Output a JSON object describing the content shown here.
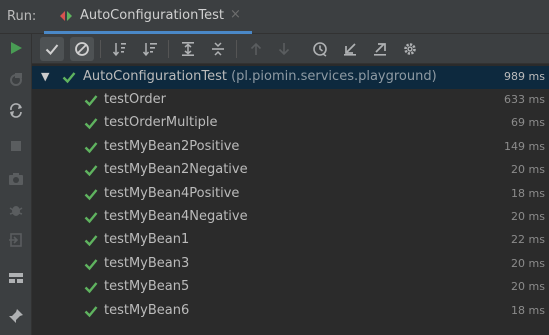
{
  "runbar": {
    "label": "Run:",
    "tab_title": "AutoConfigurationTest",
    "tab_close": "×"
  },
  "colors": {
    "pass": "#5fb35f",
    "accent": "#4a88c7",
    "run_green": "#499c54"
  },
  "toolbar": {
    "buttons": [
      {
        "name": "show-passed-toggle",
        "icon": "check-icon",
        "toggled": true
      },
      {
        "name": "show-ignored-toggle",
        "icon": "cancel-circle-icon",
        "toggled": true
      },
      {
        "name": "sort-alphabetically-button",
        "icon": "sort-alpha-icon"
      },
      {
        "name": "sort-by-duration-button",
        "icon": "sort-duration-icon"
      },
      {
        "name": "expand-all-button",
        "icon": "expand-all-icon"
      },
      {
        "name": "collapse-all-button",
        "icon": "collapse-all-icon"
      },
      {
        "name": "previous-failed-button",
        "icon": "arrow-up-icon"
      },
      {
        "name": "next-failed-button",
        "icon": "arrow-down-icon"
      },
      {
        "name": "test-history-button",
        "icon": "history-icon"
      },
      {
        "name": "import-tests-button",
        "icon": "import-icon"
      },
      {
        "name": "export-results-button",
        "icon": "export-icon"
      },
      {
        "name": "settings-button",
        "icon": "gear-icon"
      }
    ]
  },
  "left_toolbar": [
    "rerun-icon",
    "rerun-failed-icon",
    "toggle-auto-test-icon",
    "stop-icon",
    "screenshot-icon",
    "debug-icon",
    "exit-icon",
    "layout-icon",
    "pin-icon"
  ],
  "tree": {
    "root": {
      "name": "AutoConfigurationTest",
      "package": "(pl.piomin.services.playground)",
      "duration": "989 ms"
    },
    "tests": [
      {
        "name": "testOrder",
        "duration": "633 ms"
      },
      {
        "name": "testOrderMultiple",
        "duration": "69 ms"
      },
      {
        "name": "testMyBean2Positive",
        "duration": "149 ms"
      },
      {
        "name": "testMyBean2Negative",
        "duration": "20 ms"
      },
      {
        "name": "testMyBean4Positive",
        "duration": "18 ms"
      },
      {
        "name": "testMyBean4Negative",
        "duration": "20 ms"
      },
      {
        "name": "testMyBean1",
        "duration": "22 ms"
      },
      {
        "name": "testMyBean3",
        "duration": "20 ms"
      },
      {
        "name": "testMyBean5",
        "duration": "20 ms"
      },
      {
        "name": "testMyBean6",
        "duration": "18 ms"
      }
    ]
  }
}
